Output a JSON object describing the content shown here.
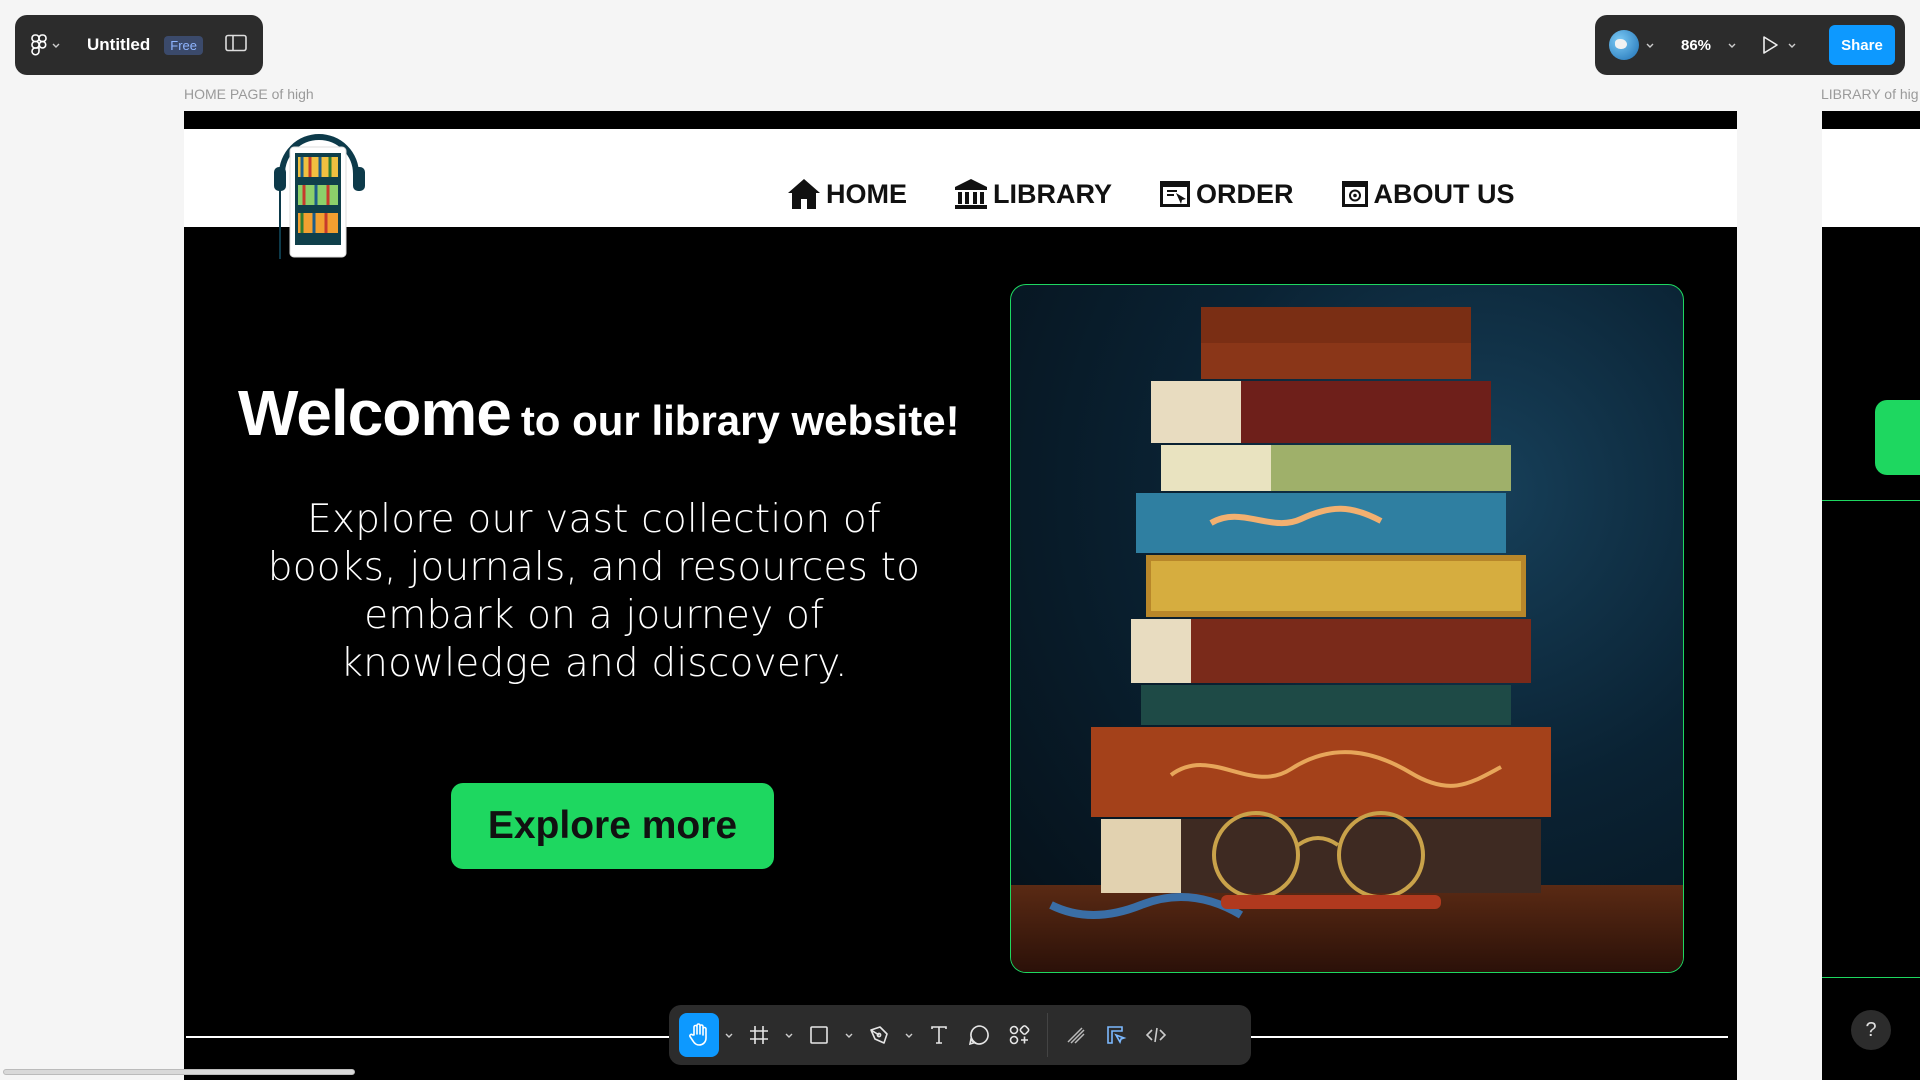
{
  "editor": {
    "file_title": "Untitled",
    "plan_badge": "Free",
    "zoom_level": "86%",
    "share_label": "Share"
  },
  "frames": {
    "home_label": "HOME PAGE of high",
    "library_label": "LIBRARY of hig"
  },
  "site": {
    "nav": [
      {
        "label": "HOME",
        "icon": "home-icon"
      },
      {
        "label": "LIBRARY",
        "icon": "bank-icon"
      },
      {
        "label": "ORDER",
        "icon": "order-icon"
      },
      {
        "label": "ABOUT US",
        "icon": "about-icon"
      }
    ],
    "hero": {
      "title_big": "Welcome",
      "title_rest": "to our library website!",
      "text": "Explore our vast collection of books, journals, and resources to embark on a journey of knowledge and discovery.",
      "cta": "Explore more"
    }
  },
  "toolbar": {
    "tools": [
      "hand-tool",
      "frame-tool",
      "rectangle-tool",
      "pen-tool",
      "text-tool",
      "comment-tool",
      "actions-tool",
      "draw-mode",
      "design-mode",
      "dev-mode"
    ]
  },
  "help_label": "?",
  "colors": {
    "accent_green": "#1ed760",
    "editor_blue": "#0d99ff",
    "toolbar_bg": "#2c2c2c"
  }
}
